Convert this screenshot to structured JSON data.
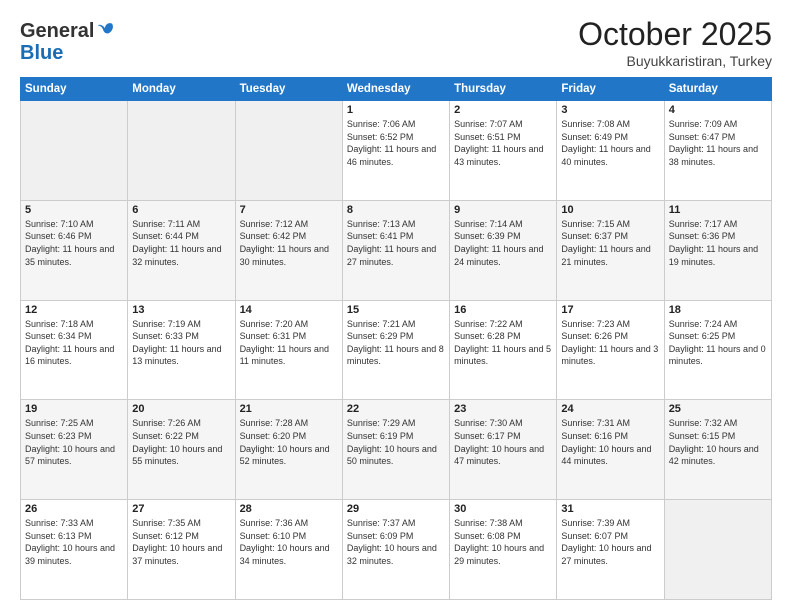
{
  "logo": {
    "general": "General",
    "blue": "Blue"
  },
  "title": "October 2025",
  "subtitle": "Buyukkaristiran, Turkey",
  "days_of_week": [
    "Sunday",
    "Monday",
    "Tuesday",
    "Wednesday",
    "Thursday",
    "Friday",
    "Saturday"
  ],
  "weeks": [
    [
      {
        "day": "",
        "info": ""
      },
      {
        "day": "",
        "info": ""
      },
      {
        "day": "",
        "info": ""
      },
      {
        "day": "1",
        "info": "Sunrise: 7:06 AM\nSunset: 6:52 PM\nDaylight: 11 hours and 46 minutes."
      },
      {
        "day": "2",
        "info": "Sunrise: 7:07 AM\nSunset: 6:51 PM\nDaylight: 11 hours and 43 minutes."
      },
      {
        "day": "3",
        "info": "Sunrise: 7:08 AM\nSunset: 6:49 PM\nDaylight: 11 hours and 40 minutes."
      },
      {
        "day": "4",
        "info": "Sunrise: 7:09 AM\nSunset: 6:47 PM\nDaylight: 11 hours and 38 minutes."
      }
    ],
    [
      {
        "day": "5",
        "info": "Sunrise: 7:10 AM\nSunset: 6:46 PM\nDaylight: 11 hours and 35 minutes."
      },
      {
        "day": "6",
        "info": "Sunrise: 7:11 AM\nSunset: 6:44 PM\nDaylight: 11 hours and 32 minutes."
      },
      {
        "day": "7",
        "info": "Sunrise: 7:12 AM\nSunset: 6:42 PM\nDaylight: 11 hours and 30 minutes."
      },
      {
        "day": "8",
        "info": "Sunrise: 7:13 AM\nSunset: 6:41 PM\nDaylight: 11 hours and 27 minutes."
      },
      {
        "day": "9",
        "info": "Sunrise: 7:14 AM\nSunset: 6:39 PM\nDaylight: 11 hours and 24 minutes."
      },
      {
        "day": "10",
        "info": "Sunrise: 7:15 AM\nSunset: 6:37 PM\nDaylight: 11 hours and 21 minutes."
      },
      {
        "day": "11",
        "info": "Sunrise: 7:17 AM\nSunset: 6:36 PM\nDaylight: 11 hours and 19 minutes."
      }
    ],
    [
      {
        "day": "12",
        "info": "Sunrise: 7:18 AM\nSunset: 6:34 PM\nDaylight: 11 hours and 16 minutes."
      },
      {
        "day": "13",
        "info": "Sunrise: 7:19 AM\nSunset: 6:33 PM\nDaylight: 11 hours and 13 minutes."
      },
      {
        "day": "14",
        "info": "Sunrise: 7:20 AM\nSunset: 6:31 PM\nDaylight: 11 hours and 11 minutes."
      },
      {
        "day": "15",
        "info": "Sunrise: 7:21 AM\nSunset: 6:29 PM\nDaylight: 11 hours and 8 minutes."
      },
      {
        "day": "16",
        "info": "Sunrise: 7:22 AM\nSunset: 6:28 PM\nDaylight: 11 hours and 5 minutes."
      },
      {
        "day": "17",
        "info": "Sunrise: 7:23 AM\nSunset: 6:26 PM\nDaylight: 11 hours and 3 minutes."
      },
      {
        "day": "18",
        "info": "Sunrise: 7:24 AM\nSunset: 6:25 PM\nDaylight: 11 hours and 0 minutes."
      }
    ],
    [
      {
        "day": "19",
        "info": "Sunrise: 7:25 AM\nSunset: 6:23 PM\nDaylight: 10 hours and 57 minutes."
      },
      {
        "day": "20",
        "info": "Sunrise: 7:26 AM\nSunset: 6:22 PM\nDaylight: 10 hours and 55 minutes."
      },
      {
        "day": "21",
        "info": "Sunrise: 7:28 AM\nSunset: 6:20 PM\nDaylight: 10 hours and 52 minutes."
      },
      {
        "day": "22",
        "info": "Sunrise: 7:29 AM\nSunset: 6:19 PM\nDaylight: 10 hours and 50 minutes."
      },
      {
        "day": "23",
        "info": "Sunrise: 7:30 AM\nSunset: 6:17 PM\nDaylight: 10 hours and 47 minutes."
      },
      {
        "day": "24",
        "info": "Sunrise: 7:31 AM\nSunset: 6:16 PM\nDaylight: 10 hours and 44 minutes."
      },
      {
        "day": "25",
        "info": "Sunrise: 7:32 AM\nSunset: 6:15 PM\nDaylight: 10 hours and 42 minutes."
      }
    ],
    [
      {
        "day": "26",
        "info": "Sunrise: 7:33 AM\nSunset: 6:13 PM\nDaylight: 10 hours and 39 minutes."
      },
      {
        "day": "27",
        "info": "Sunrise: 7:35 AM\nSunset: 6:12 PM\nDaylight: 10 hours and 37 minutes."
      },
      {
        "day": "28",
        "info": "Sunrise: 7:36 AM\nSunset: 6:10 PM\nDaylight: 10 hours and 34 minutes."
      },
      {
        "day": "29",
        "info": "Sunrise: 7:37 AM\nSunset: 6:09 PM\nDaylight: 10 hours and 32 minutes."
      },
      {
        "day": "30",
        "info": "Sunrise: 7:38 AM\nSunset: 6:08 PM\nDaylight: 10 hours and 29 minutes."
      },
      {
        "day": "31",
        "info": "Sunrise: 7:39 AM\nSunset: 6:07 PM\nDaylight: 10 hours and 27 minutes."
      },
      {
        "day": "",
        "info": ""
      }
    ]
  ]
}
